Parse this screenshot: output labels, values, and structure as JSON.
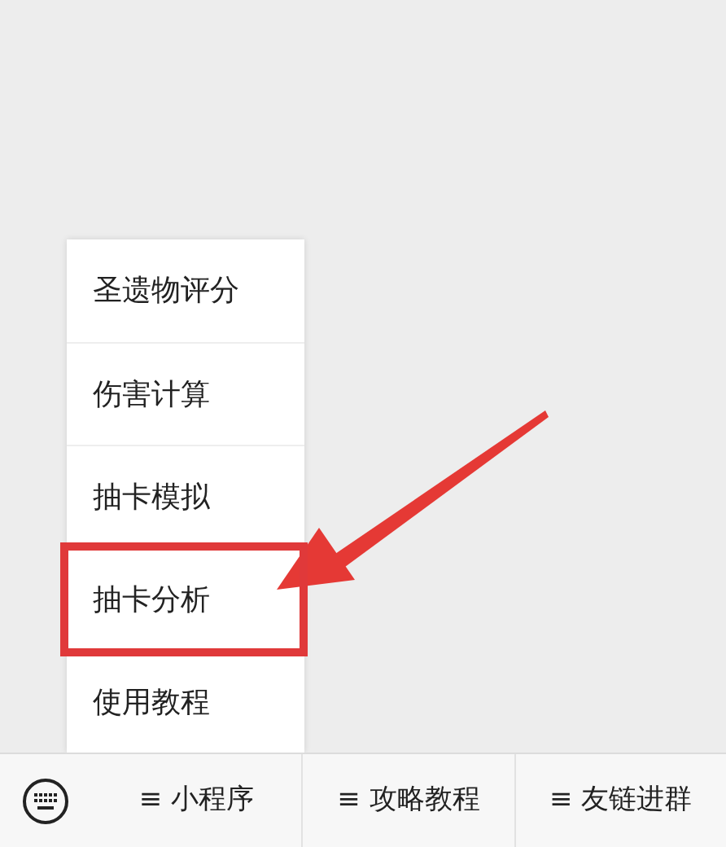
{
  "popup_menu": {
    "items": [
      {
        "label": "圣遗物评分",
        "highlighted": false
      },
      {
        "label": "伤害计算",
        "highlighted": false
      },
      {
        "label": "抽卡模拟",
        "highlighted": false
      },
      {
        "label": "抽卡分析",
        "highlighted": true
      },
      {
        "label": "使用教程",
        "highlighted": false
      }
    ]
  },
  "bottom_menu": {
    "items": [
      {
        "icon": "≡",
        "label": "小程序"
      },
      {
        "icon": "≡",
        "label": "攻略教程"
      },
      {
        "icon": "≡",
        "label": "友链进群"
      }
    ]
  }
}
